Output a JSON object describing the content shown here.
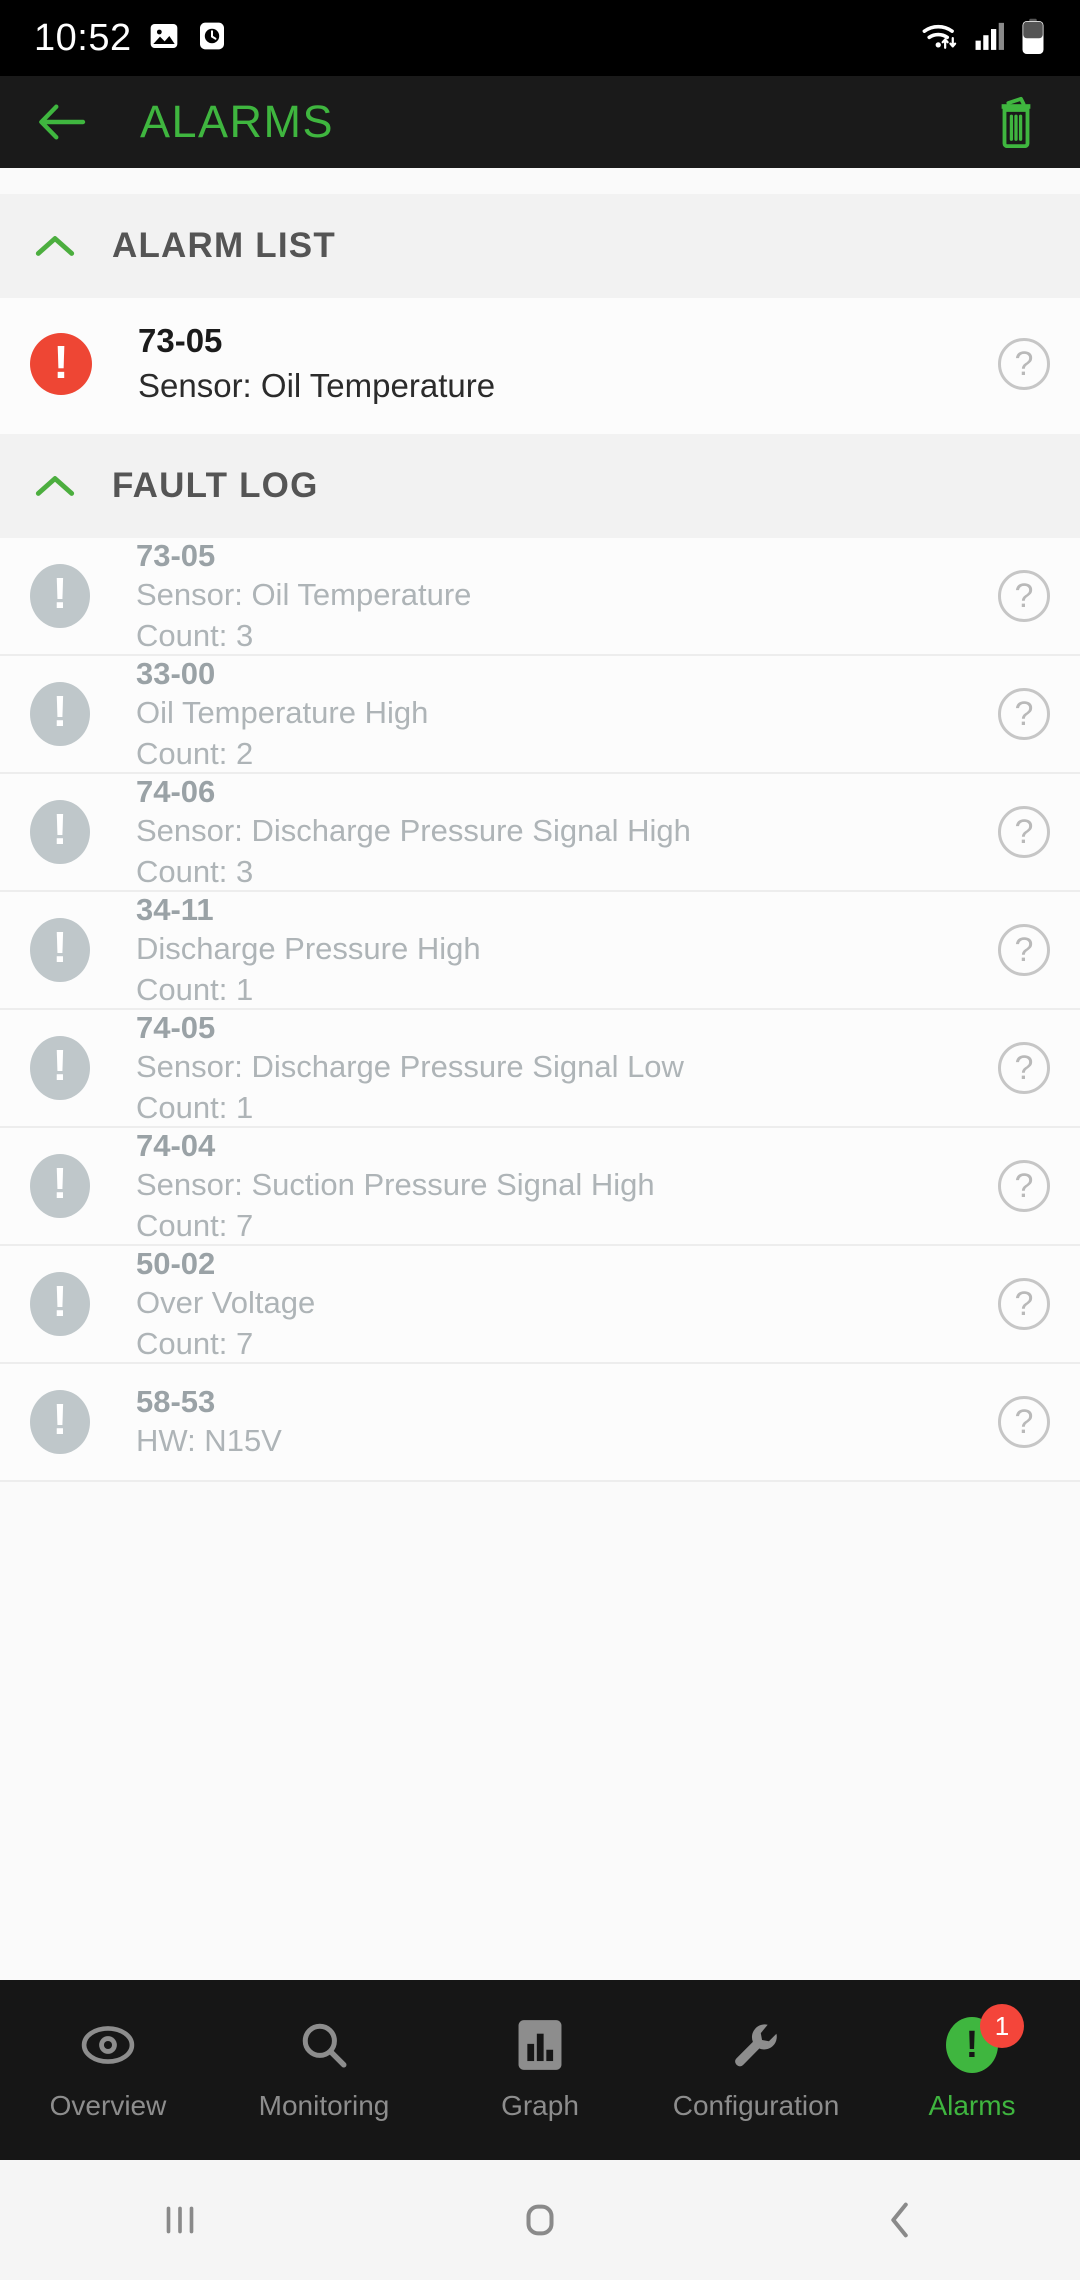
{
  "status_bar": {
    "time": "10:52",
    "icons_left": [
      "image-icon",
      "clock-icon"
    ],
    "icons_right": [
      "wifi-icon",
      "cellular-signal-icon",
      "battery-icon"
    ]
  },
  "app_bar": {
    "back_label": "back-arrow",
    "title": "ALARMS",
    "delete_label": "trash-icon",
    "accent_color": "#3fb63f",
    "background_color": "#1a1a1a"
  },
  "alarm_list": {
    "header": "ALARM LIST",
    "expanded": true,
    "items": [
      {
        "code": "73-05",
        "description": "Sensor: Oil Temperature",
        "severity_color": "#ee4634",
        "help": "?"
      }
    ]
  },
  "fault_log": {
    "header": "FAULT LOG",
    "expanded": true,
    "count_prefix": "Count: ",
    "items": [
      {
        "code": "73-05",
        "description": "Sensor: Oil Temperature",
        "count": "Count: 3",
        "help": "?"
      },
      {
        "code": "33-00",
        "description": "Oil Temperature High",
        "count": "Count: 2",
        "help": "?"
      },
      {
        "code": "74-06",
        "description": "Sensor: Discharge Pressure Signal High",
        "count": "Count: 3",
        "help": "?"
      },
      {
        "code": "34-11",
        "description": "Discharge Pressure High",
        "count": "Count: 1",
        "help": "?"
      },
      {
        "code": "74-05",
        "description": "Sensor: Discharge Pressure Signal Low",
        "count": "Count: 1",
        "help": "?"
      },
      {
        "code": "74-04",
        "description": "Sensor: Suction Pressure Signal High",
        "count": "Count: 7",
        "help": "?"
      },
      {
        "code": "50-02",
        "description": "Over Voltage",
        "count": "Count: 7",
        "help": "?"
      },
      {
        "code": "58-53",
        "description": "HW: N15V",
        "count": "",
        "help": "?"
      }
    ]
  },
  "bottom_nav": {
    "items": [
      {
        "label": "Overview",
        "icon": "eye-icon",
        "active": false
      },
      {
        "label": "Monitoring",
        "icon": "search-icon",
        "active": false
      },
      {
        "label": "Graph",
        "icon": "bar-chart-icon",
        "active": false
      },
      {
        "label": "Configuration",
        "icon": "wrench-icon",
        "active": false
      },
      {
        "label": "Alarms",
        "icon": "alert-icon",
        "active": true,
        "badge": "1"
      }
    ],
    "active_color": "#3fb63f",
    "badge_color": "#f4453a"
  },
  "system_nav": {
    "recents": "recents-icon",
    "home": "home-icon",
    "back": "back-icon"
  }
}
